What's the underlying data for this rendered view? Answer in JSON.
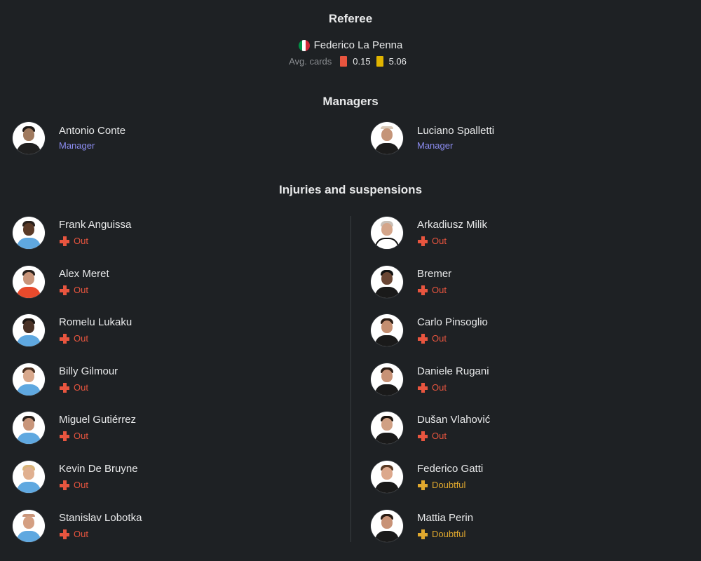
{
  "referee": {
    "title": "Referee",
    "name": "Federico La Penna",
    "flag_colors": [
      "#009246",
      "#ffffff",
      "#ce2b37"
    ],
    "avg_cards_label": "Avg. cards",
    "red_card_color": "#e8553f",
    "red_avg": "0.15",
    "yellow_card_color": "#e0b400",
    "yellow_avg": "5.06"
  },
  "managers": {
    "title": "Managers",
    "home": {
      "name": "Antonio Conte",
      "role": "Manager"
    },
    "away": {
      "name": "Luciano Spalletti",
      "role": "Manager"
    }
  },
  "injuries": {
    "title": "Injuries and suspensions",
    "home": [
      {
        "name": "Frank Anguissa",
        "status": "Out"
      },
      {
        "name": "Alex Meret",
        "status": "Out"
      },
      {
        "name": "Romelu Lukaku",
        "status": "Out"
      },
      {
        "name": "Billy Gilmour",
        "status": "Out"
      },
      {
        "name": "Miguel Gutiérrez",
        "status": "Out"
      },
      {
        "name": "Kevin De Bruyne",
        "status": "Out"
      },
      {
        "name": "Stanislav Lobotka",
        "status": "Out"
      }
    ],
    "away": [
      {
        "name": "Arkadiusz Milik",
        "status": "Out"
      },
      {
        "name": "Bremer",
        "status": "Out"
      },
      {
        "name": "Carlo Pinsoglio",
        "status": "Out"
      },
      {
        "name": "Daniele Rugani",
        "status": "Out"
      },
      {
        "name": "Dušan Vlahović",
        "status": "Out"
      },
      {
        "name": "Federico Gatti",
        "status": "Doubtful"
      },
      {
        "name": "Mattia Perin",
        "status": "Doubtful"
      }
    ]
  },
  "colors": {
    "background": "#1e2124",
    "role_accent": "#8b8cf0",
    "out": "#e8553f",
    "doubtful": "#e0a82e"
  }
}
